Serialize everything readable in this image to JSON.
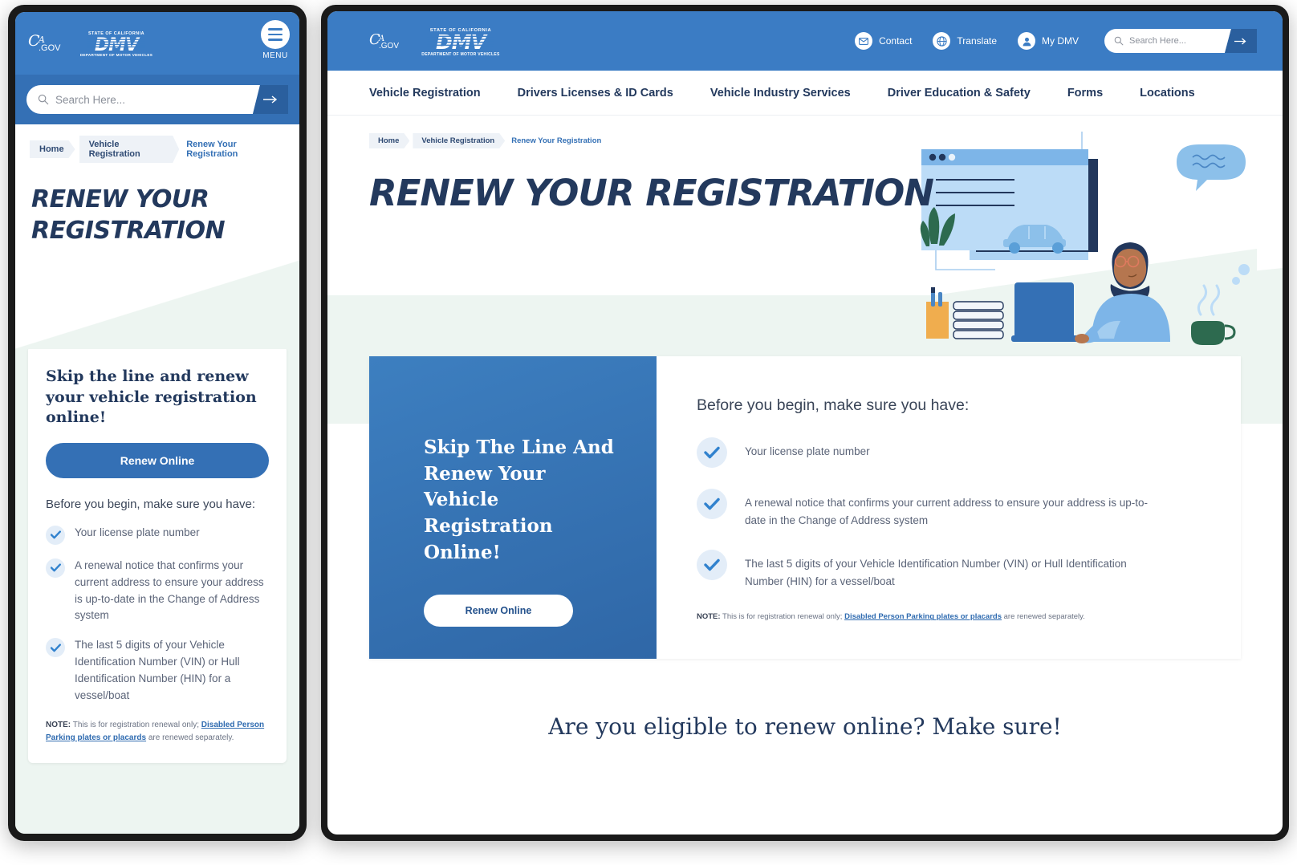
{
  "brand": {
    "ca_gov": "CA.GOV",
    "dmv_top_line": "STATE OF CALIFORNIA",
    "dmv_wordmark": "DMV",
    "dmv_bottom_line": "DEPARTMENT OF MOTOR VEHICLES",
    "blue": "#3470b5",
    "header_blue": "#3b7cc4",
    "navy": "#23395d",
    "mint": "#edf5f1",
    "check_blue": "#3182ce"
  },
  "mobile": {
    "menu_label": "MENU",
    "search": {
      "placeholder": "Search Here...",
      "value": "",
      "submit_icon": "arrow-right-icon"
    },
    "breadcrumb": [
      "Home",
      "Vehicle Registration",
      "Renew Your Registration"
    ],
    "page_title": "RENEW YOUR REGISTRATION",
    "card": {
      "heading": "Skip the line and renew your vehicle registration online!",
      "button": "Renew Online",
      "subheading": "Before you begin, make sure you have:",
      "items": [
        "Your license plate number",
        "A renewal notice that confirms your current address to ensure your address is up-to-date in the Change of Address system",
        "The last 5 digits of your Vehicle Identification Number (VIN) or Hull Identification Number (HIN) for a vessel/boat"
      ],
      "note_label": "NOTE:",
      "note_before": " This is for registration renewal only; ",
      "note_link": "Disabled Person Parking plates or placards",
      "note_after": " are renewed separately."
    }
  },
  "desktop": {
    "utility_nav": [
      {
        "label": "Contact",
        "icon": "envelope-icon"
      },
      {
        "label": "Translate",
        "icon": "globe-icon"
      },
      {
        "label": "My DMV",
        "icon": "user-icon"
      }
    ],
    "search": {
      "placeholder": "Search Here...",
      "value": "",
      "submit_icon": "arrow-right-icon"
    },
    "main_nav": [
      "Vehicle Registration",
      "Drivers Licenses & ID Cards",
      "Vehicle Industry Services",
      "Driver Education & Safety",
      "Forms",
      "Locations"
    ],
    "breadcrumb": [
      "Home",
      "Vehicle Registration",
      "Renew Your Registration"
    ],
    "page_title": "RENEW YOUR REGISTRATION",
    "blue_card": {
      "heading": "Skip The Line And Renew Your Vehicle Registration Online!",
      "button": "Renew Online"
    },
    "checklist": {
      "heading": "Before you begin, make sure you have:",
      "items": [
        "Your license plate number",
        "A renewal notice that confirms your current address to ensure your address is up-to-date in the Change of Address system",
        "The last 5 digits of your Vehicle Identification Number (VIN) or Hull Identification Number (HIN) for a vessel/boat"
      ],
      "note_label": "NOTE:",
      "note_before": " This is for registration renewal only; ",
      "note_link": "Disabled Person Parking plates or placards",
      "note_after": " are renewed separately."
    },
    "bottom_heading": "Are you eligible to renew online? Make sure!"
  }
}
